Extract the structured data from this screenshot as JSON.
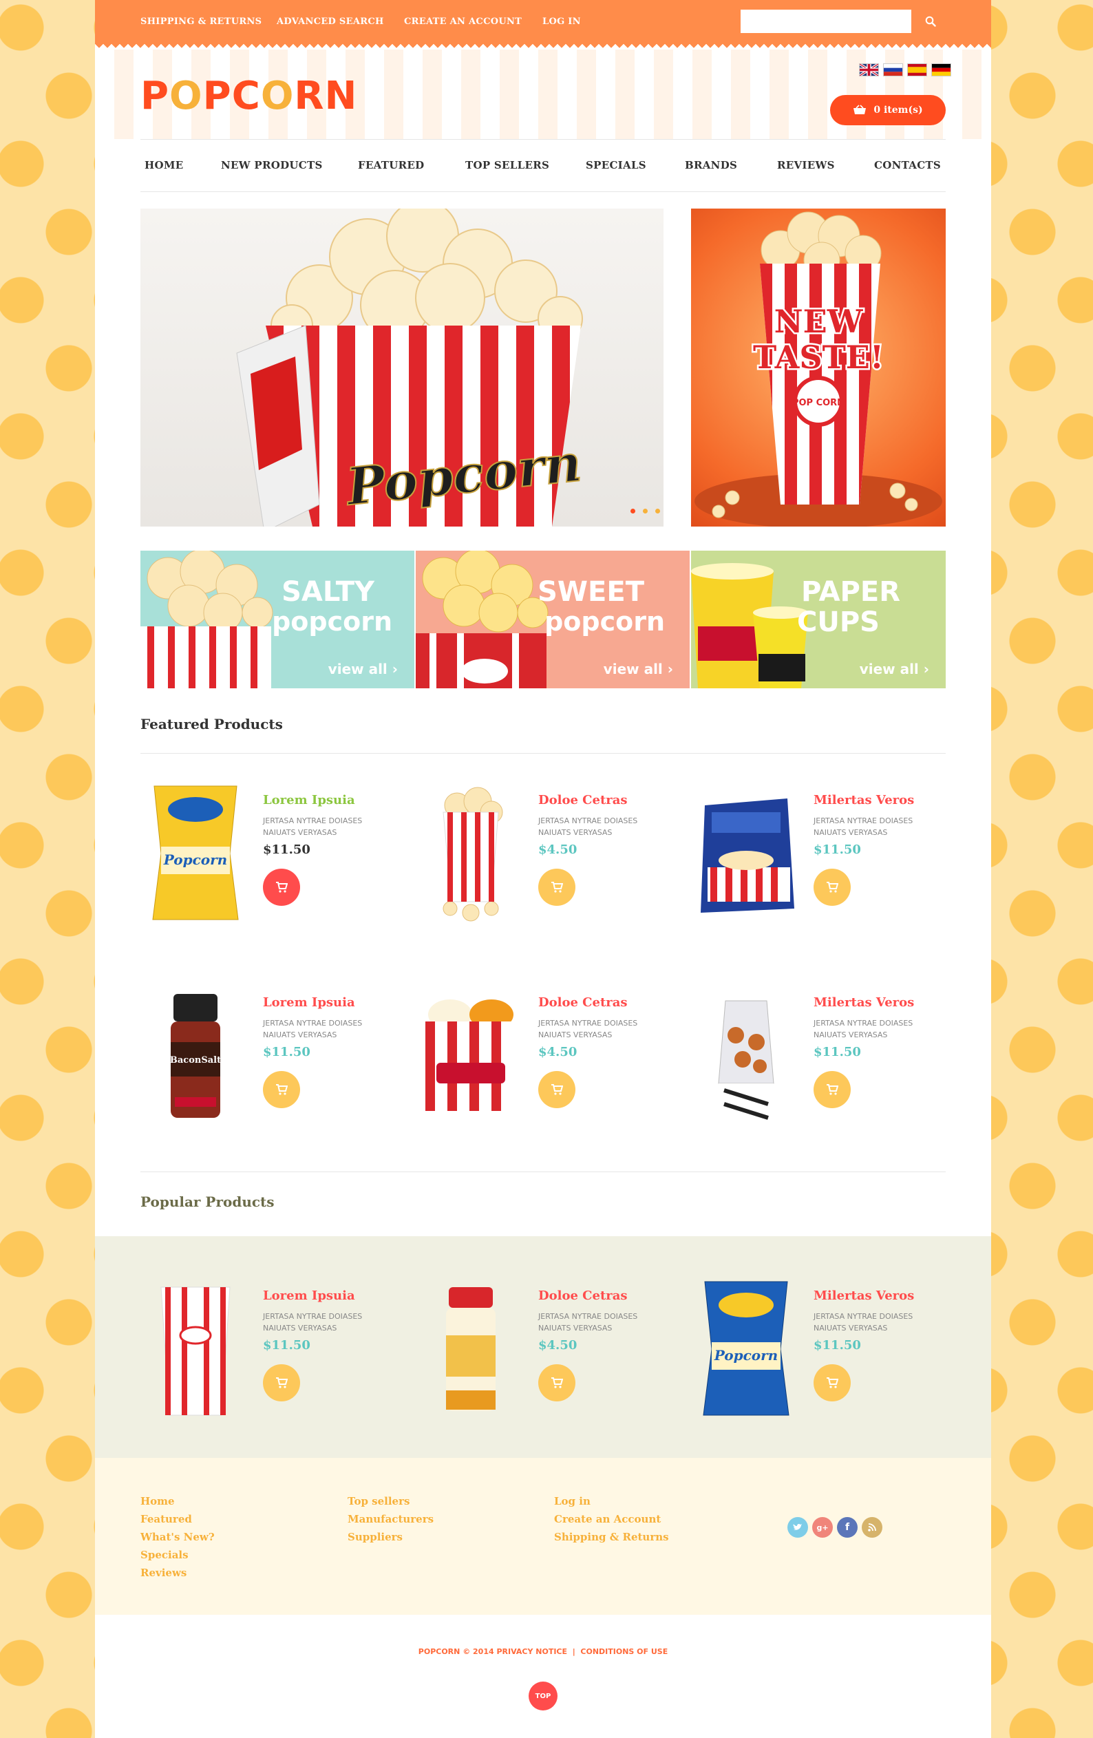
{
  "topbar": {
    "links": [
      "Shipping & Returns",
      "Advanced Search",
      "Create an Account",
      "Log In"
    ],
    "search_placeholder": ""
  },
  "header": {
    "logo_letters": [
      "P",
      "O",
      "P",
      "C",
      "O",
      "R",
      "N"
    ],
    "logo_colors": [
      "#ff4c1f",
      "#f7b13a",
      "#ff4c1f",
      "#ff4c1f",
      "#f7b13a",
      "#ff4c1f",
      "#ff4c1f"
    ],
    "cart_label": "0 item(s)",
    "flags": [
      "flag-uk-icon",
      "flag-ru-icon",
      "flag-es-icon",
      "flag-de-icon"
    ]
  },
  "nav": [
    "Home",
    "New Products",
    "Featured",
    "Top Sellers",
    "Specials",
    "Brands",
    "Reviews",
    "Contacts"
  ],
  "slider": {
    "title": "Popcorn",
    "dots": 3,
    "active_dot": 0
  },
  "promo": {
    "line1": "NEW",
    "line2": "TASTE!",
    "box_text": "POP CORN"
  },
  "banners": [
    {
      "line1": "SALTY",
      "line2": "popcorn",
      "cta": "view all",
      "bg": "#a8e0d8"
    },
    {
      "line1": "SWEET",
      "line2": "popcorn",
      "cta": "view all",
      "bg": "#f7a891"
    },
    {
      "line1": "PAPER",
      "line2": "CUPS",
      "cta": "view all",
      "bg": "#c9dd94"
    }
  ],
  "featured": {
    "title": "Featured Products",
    "products": [
      {
        "name": "Lorem Ipsuia",
        "desc": "Jertasa nytrae doiases naiuats veryasas",
        "price": "$11.50",
        "name_color": "#8cc63f",
        "price_color": "#333333",
        "btn_color": "#ff4c4c"
      },
      {
        "name": "Doloe Cetras",
        "desc": "Jertasa nytrae doiases naiuats veryasas",
        "price": "$4.50",
        "name_color": "#ff4c4c",
        "price_color": "#5cc6c0",
        "btn_color": "#fdc85a"
      },
      {
        "name": "Milertas Veros",
        "desc": "Jertasa nytrae doiases naiuats veryasas",
        "price": "$11.50",
        "name_color": "#ff4c4c",
        "price_color": "#5cc6c0",
        "btn_color": "#fdc85a"
      },
      {
        "name": "Lorem Ipsuia",
        "desc": "Jertasa nytrae doiases naiuats veryasas",
        "price": "$11.50",
        "name_color": "#ff4c4c",
        "price_color": "#5cc6c0",
        "btn_color": "#fdc85a"
      },
      {
        "name": "Doloe Cetras",
        "desc": "Jertasa nytrae doiases naiuats veryasas",
        "price": "$4.50",
        "name_color": "#ff4c4c",
        "price_color": "#5cc6c0",
        "btn_color": "#fdc85a"
      },
      {
        "name": "Milertas Veros",
        "desc": "Jertasa nytrae doiases naiuats veryasas",
        "price": "$11.50",
        "name_color": "#ff4c4c",
        "price_color": "#5cc6c0",
        "btn_color": "#fdc85a"
      }
    ]
  },
  "popular": {
    "title": "Popular Products",
    "products": [
      {
        "name": "Lorem Ipsuia",
        "desc": "Jertasa nytrae doiases naiuats veryasas",
        "price": "$11.50",
        "name_color": "#ff4c4c",
        "price_color": "#5cc6c0",
        "btn_color": "#fdc85a"
      },
      {
        "name": "Doloe Cetras",
        "desc": "Jertasa nytrae doiases naiuats veryasas",
        "price": "$4.50",
        "name_color": "#ff4c4c",
        "price_color": "#5cc6c0",
        "btn_color": "#fdc85a"
      },
      {
        "name": "Milertas Veros",
        "desc": "Jertasa nytrae doiases naiuats veryasas",
        "price": "$11.50",
        "name_color": "#ff4c4c",
        "price_color": "#5cc6c0",
        "btn_color": "#fdc85a"
      }
    ]
  },
  "footer": {
    "col1": [
      "Home",
      "Featured",
      "What's New?",
      "Specials",
      "Reviews"
    ],
    "col2": [
      "Top sellers",
      "Manufacturers",
      "Suppliers"
    ],
    "col3": [
      "Log in",
      "Create an Account",
      "Shipping & Returns"
    ],
    "social": [
      {
        "icon": "twitter-icon",
        "color": "#7ecde8",
        "glyph": "t"
      },
      {
        "icon": "google-plus-icon",
        "color": "#f0857a",
        "glyph": "g+"
      },
      {
        "icon": "facebook-icon",
        "color": "#5b76b9",
        "glyph": "f"
      },
      {
        "icon": "rss-icon",
        "color": "#d6b36a",
        "glyph": "⊚"
      }
    ],
    "copyright_brand": "Popcorn",
    "copyright_year": "© 2014",
    "privacy": "Privacy Notice",
    "separator": "|",
    "conditions": "Conditions of Use",
    "top_label": "TOP"
  }
}
